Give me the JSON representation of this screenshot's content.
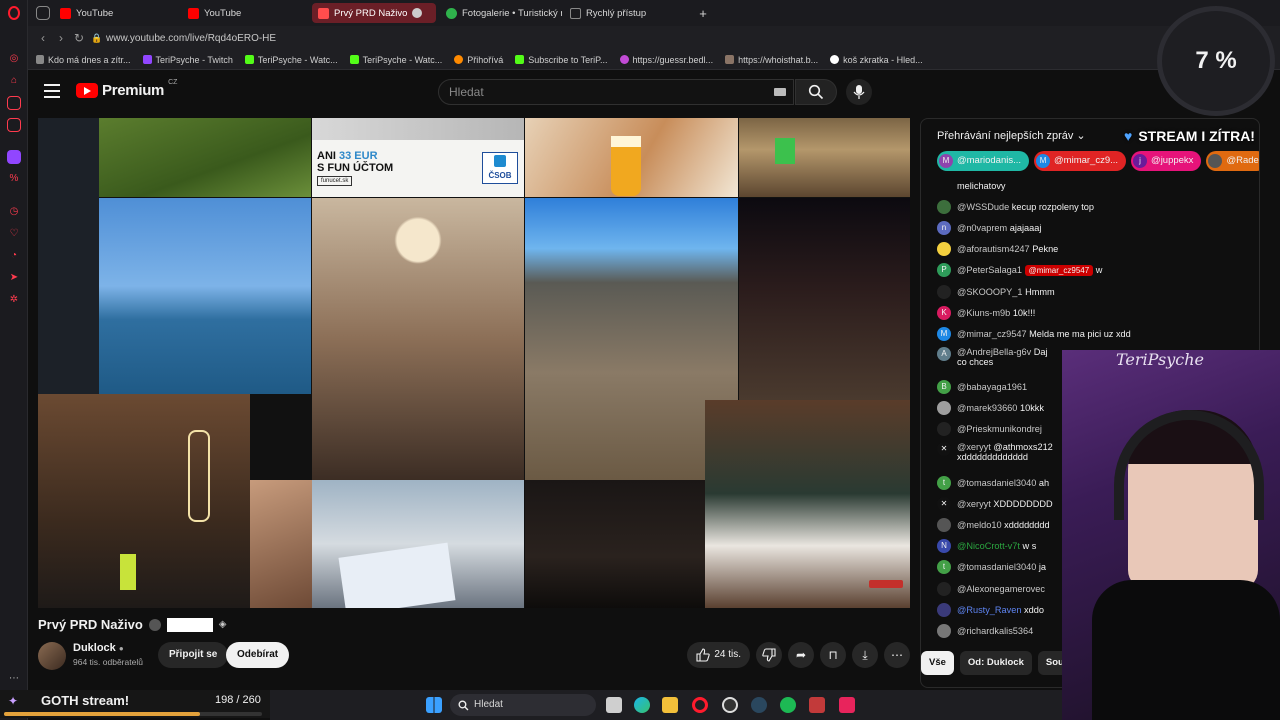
{
  "browser": {
    "tabs": [
      {
        "label": "YouTube",
        "favicon_color": "#ff0000"
      },
      {
        "label": "YouTube",
        "favicon_color": "#ff0000"
      },
      {
        "label": "Prvý PRD Naživo",
        "favicon_color": "#ff0000",
        "active": true
      },
      {
        "label": "Fotogalerie • Turistický ro",
        "favicon_color": "#2fb24c"
      },
      {
        "label": "Rychlý přístup",
        "favicon_color": "#888888"
      }
    ],
    "url": "www.youtube.com/live/Rqd4oERO-HE",
    "bookmarks": [
      "Kdo má dnes a zítr...",
      "TeriPsyche - Twitch",
      "TeriPsyche - Watc...",
      "TeriPsyche - Watc...",
      "Přihořívá",
      "Subscribe to TeriP...",
      "https://guessr.bedl...",
      "https://whoisthat.b...",
      "koš zkratka - Hled..."
    ]
  },
  "youtube": {
    "logo_text": "Premium",
    "region": "CZ",
    "search_placeholder": "Hledat"
  },
  "video": {
    "ad_line1": "ANI",
    "ad_amount": "33 EUR",
    "ad_line2": "S FUN ÚČTOM",
    "ad_domain": "funucet.sk",
    "ad_brand": "ČSOB",
    "title": "Prvý PRD Naživo",
    "channel": "Duklock",
    "subscribers": "964 tis. odběratelů",
    "join_label": "Připojit se",
    "subscribe_label": "Odebírat",
    "likes": "24 tis."
  },
  "chat": {
    "header": "Přehrávání nejlepších zpráv",
    "tickers": [
      {
        "user": "@mariodanis...",
        "bg": "#1fb8a5",
        "initial": "M"
      },
      {
        "user": "@mimar_cz9...",
        "bg": "#e02424",
        "initial": "M"
      },
      {
        "user": "@juppekx",
        "bg": "#e6137a",
        "initial": "j"
      },
      {
        "user": "@Rade",
        "bg": "#e06a10",
        "initial": ""
      }
    ],
    "messages": [
      {
        "user": "",
        "text": "melichatovy",
        "avatar": "",
        "color": "#333333"
      },
      {
        "user": "@WSSDude",
        "text": "kecup rozpoleny top",
        "avatar": "",
        "color": "#3c6e3c"
      },
      {
        "user": "@n0vaprem",
        "text": "ajajaaaj",
        "avatar": "n",
        "color": "#5c6bc0"
      },
      {
        "user": "@aforautism4247",
        "text": "Pekne",
        "avatar": "",
        "color": "#f4d03f"
      },
      {
        "user": "@PeterSalaga1",
        "mention": "@mimar_cz9547",
        "text": "w",
        "avatar": "P",
        "color": "#2e9c5a"
      },
      {
        "user": "@SKOOOPY_1",
        "text": "Hmmm",
        "avatar": "",
        "color": "#222222"
      },
      {
        "user": "@Kiuns-m9b",
        "text": "10k!!!",
        "avatar": "K",
        "color": "#d81b60"
      },
      {
        "user": "@mimar_cz9547",
        "text": "Melda me ma pici uz xdd",
        "avatar": "M",
        "color": "#1e88e5"
      },
      {
        "user": "@AndrejBella-g6v",
        "text": "Daj",
        "text2": "co chces",
        "avatar": "A",
        "color": "#607d8b",
        "tall": true
      },
      {
        "user": "@babayaga1961",
        "text": "",
        "avatar": "B",
        "color": "#43a047"
      },
      {
        "user": "@marek93660",
        "text": "10kkk",
        "avatar": "",
        "color": "#9e9e9e"
      },
      {
        "user": "@Prieskmunikondrej",
        "text": "",
        "avatar": "",
        "color": "#222222"
      },
      {
        "user": "@xeryyt",
        "text": "@athmoxs212",
        "text2": "xddddddddddddd",
        "avatar": "✕",
        "color": "#111111",
        "tall": true
      },
      {
        "user": "@tomasdaniel3040",
        "text": "ah",
        "avatar": "t",
        "color": "#43a047"
      },
      {
        "user": "@xeryyt",
        "text": "XDDDDDDDD",
        "avatar": "✕",
        "color": "#111111"
      },
      {
        "user": "@meldo10",
        "text": "xdddddddd",
        "avatar": "",
        "color": "#555555"
      },
      {
        "user": "@NicoCrott-v7t",
        "text": "w s",
        "avatar": "N",
        "color": "#3949ab",
        "role": "member"
      },
      {
        "user": "@tomasdaniel3040",
        "text": "ja",
        "avatar": "t",
        "color": "#43a047"
      },
      {
        "user": "@Alexonegamerovec",
        "text": "",
        "avatar": "",
        "color": "#222222"
      },
      {
        "user": "@Rusty_Raven",
        "text": "xddo",
        "avatar": "",
        "color": "#3a3a7a",
        "role": "mod"
      },
      {
        "user": "@richardkalis5364",
        "text": "",
        "avatar": "",
        "color": "#777777"
      }
    ],
    "filter_tabs": [
      "Vše",
      "Od: Duklock",
      "Souvi"
    ]
  },
  "overlay": {
    "banner": "STREAM I ZÍTRA!",
    "progress": "7 %",
    "cam_name": "TeriPsyche",
    "goal_title": "GOTH stream!",
    "goal_count": "198 / 260",
    "goal_fraction": 0.76
  },
  "taskbar": {
    "search_placeholder": "Hledat"
  }
}
